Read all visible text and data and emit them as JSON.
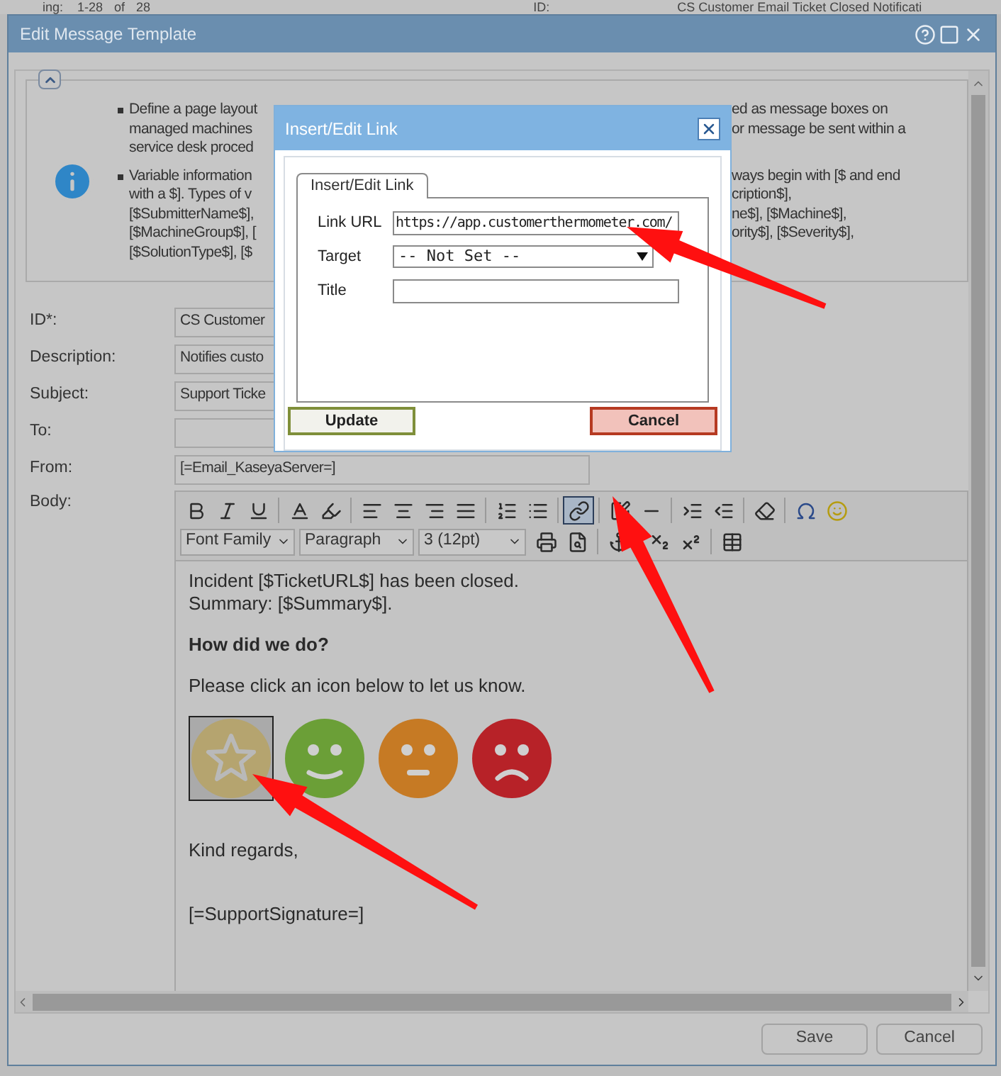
{
  "background": {
    "texts": [
      "ing:",
      "1-28",
      "of",
      "28",
      "ID:",
      "CS Customer Email Ticket Closed Notificati"
    ]
  },
  "window": {
    "title": "Edit Message Template"
  },
  "info": {
    "bullets": [
      {
        "left": [
          "Define a page layout",
          "managed machines",
          "service desk proced"
        ],
        "right": [
          "ed as message boxes on",
          "or message be sent within a"
        ]
      },
      {
        "left": [
          "Variable information",
          "with a $]. Types of v",
          "[$SubmitterName$],",
          "[$MachineGroup$], [",
          "[$SolutionType$], [$"
        ],
        "right": [
          "ways begin with [$ and end",
          "cription$],",
          "ne$], [$Machine$],",
          "ority$], [$Severity$],"
        ]
      }
    ]
  },
  "form": [
    {
      "label": "ID*:",
      "value": "CS Customer"
    },
    {
      "label": "Description:",
      "value": "Notifies custo"
    },
    {
      "label": "Subject:",
      "value": "Support Ticke"
    },
    {
      "label": "To:"
    },
    {
      "label": "From:",
      "value": "[=Email_KaseyaServer=]"
    }
  ],
  "body_label": "Body:",
  "editor": {
    "toolbar_row_1": [
      {
        "kind": "bold",
        "selected": false
      },
      {
        "kind": "italic",
        "selected": false
      },
      {
        "kind": "underline",
        "selected": false
      },
      {
        "kind": "sep"
      },
      {
        "kind": "text-color",
        "selected": false
      },
      {
        "kind": "highlight",
        "selected": false
      },
      {
        "kind": "sep"
      },
      {
        "kind": "align-left",
        "selected": false
      },
      {
        "kind": "align-center",
        "selected": false
      },
      {
        "kind": "align-right",
        "selected": false
      },
      {
        "kind": "align-justify",
        "selected": false
      },
      {
        "kind": "sep"
      },
      {
        "kind": "ordered-list",
        "selected": false
      },
      {
        "kind": "bullet-list",
        "selected": false
      },
      {
        "kind": "sep"
      },
      {
        "kind": "link",
        "selected": true
      },
      {
        "kind": "sep"
      },
      {
        "kind": "edit",
        "selected": false
      },
      {
        "kind": "rule",
        "selected": false
      },
      {
        "kind": "sep"
      },
      {
        "kind": "indent",
        "selected": false
      },
      {
        "kind": "outdent",
        "selected": false
      },
      {
        "kind": "sep"
      },
      {
        "kind": "eraser",
        "selected": false
      },
      {
        "kind": "sep"
      },
      {
        "kind": "omega",
        "selected": false
      },
      {
        "kind": "smiley",
        "selected": false
      }
    ],
    "selects": [
      "Font Family",
      "Paragraph",
      "3 (12pt)"
    ],
    "toolbar_row_2": [
      {
        "kind": "print",
        "selected": false
      },
      {
        "kind": "preview",
        "selected": false
      },
      {
        "kind": "sep"
      },
      {
        "kind": "anchor",
        "selected": false
      },
      {
        "kind": "sep"
      },
      {
        "kind": "subscript",
        "selected": false
      },
      {
        "kind": "superscript",
        "selected": false
      },
      {
        "kind": "sep"
      },
      {
        "kind": "table",
        "selected": false
      }
    ],
    "content": [
      {
        "kind": "lines",
        "lines": [
          "Incident [$TicketURL$] has been closed.",
          "Summary: [$Summary$]."
        ]
      },
      {
        "kind": "heading",
        "text": "How did we do?"
      },
      {
        "kind": "text",
        "text": "Please click an icon below to let us know."
      },
      {
        "kind": "rating",
        "faces": [
          {
            "kind": "star",
            "color": "#b5a46f",
            "selected": true
          },
          {
            "kind": "happy",
            "color": "#6b9f37",
            "selected": false
          },
          {
            "kind": "neutral",
            "color": "#c67a24",
            "selected": false
          },
          {
            "kind": "sad",
            "color": "#b72228",
            "selected": false
          }
        ]
      },
      {
        "kind": "text",
        "text": "Kind regards,"
      },
      {
        "kind": "text",
        "text": "[=SupportSignature=]"
      }
    ]
  },
  "footer_buttons": [
    "Save",
    "Cancel"
  ],
  "dialog": {
    "title": "Insert/Edit Link",
    "tab": {
      "label": "Insert/Edit Link",
      "selected": true
    },
    "fields": [
      {
        "kind": "text",
        "label": "Link URL",
        "value": "https://app.customerthermometer.com/"
      },
      {
        "kind": "select",
        "label": "Target",
        "value": "-- Not Set --"
      },
      {
        "kind": "text",
        "label": "Title"
      }
    ],
    "buttons": [
      {
        "kind": "confirm",
        "label": "Update"
      },
      {
        "kind": "cancel",
        "label": "Cancel"
      }
    ]
  }
}
